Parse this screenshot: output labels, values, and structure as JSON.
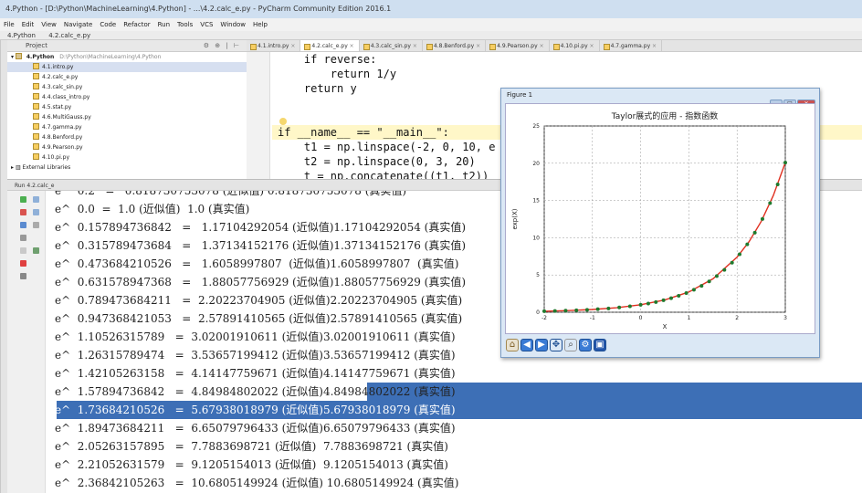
{
  "window_title": "4.Python - [D:\\Python\\MachineLearning\\4.Python] - ...\\4.2.calc_e.py - PyCharm Community Edition 2016.1",
  "menu": [
    "File",
    "Edit",
    "View",
    "Navigate",
    "Code",
    "Refactor",
    "Run",
    "Tools",
    "VCS",
    "Window",
    "Help"
  ],
  "breadcrumb": [
    "4.Python",
    "4.2.calc_e.py"
  ],
  "project": {
    "header": "Project",
    "root": "4.Python",
    "root_path": "D:\\Python\\MachineLearning\\4.Python",
    "files": [
      "4.1.intro.py",
      "4.2.calc_e.py",
      "4.3.calc_sin.py",
      "4.4.class_intro.py",
      "4.5.stat.py",
      "4.6.MultiGauss.py",
      "4.7.gamma.py",
      "4.8.Benford.py",
      "4.9.Pearson.py",
      "4.10.pi.py"
    ],
    "external": "External Libraries"
  },
  "tabs": [
    "4.1.intro.py",
    "4.2.calc_e.py",
    "4.3.calc_sin.py",
    "4.8.Benford.py",
    "4.9.Pearson.py",
    "4.10.pi.py",
    "4.7.gamma.py"
  ],
  "active_tab": 1,
  "code": {
    "l1": "    if reverse:",
    "l2": "        return 1/y",
    "l3": "    return y",
    "l4": "if __name__ == \"__main__\":",
    "l5": "    t1 = np.linspace(-2, 0, 10, e",
    "l6": "    t2 = np.linspace(0, 3, 20)",
    "l7": "    t = np.concatenate((t1, t2))"
  },
  "run_tab": "Run  4.2.calc_e",
  "console": [
    "e^  0.2   =   0.818730753078 (近似值) 0.818730753078 (真实值)",
    "e^  0.0  =  1.0 (近似值)  1.0 (真实值)",
    "e^  0.157894736842   =   1.17104292054 (近似值)1.17104292054 (真实值)",
    "e^  0.315789473684   =   1.37134152176 (近似值)1.37134152176 (真实值)",
    "e^  0.473684210526   =   1.6058997807  (近似值)1.6058997807  (真实值)",
    "e^  0.631578947368   =   1.88057756929 (近似值)1.88057756929 (真实值)",
    "e^  0.789473684211   =  2.20223704905 (近似值)2.20223704905 (真实值)",
    "e^  0.947368421053   =  2.57891410565 (近似值)2.57891410565 (真实值)",
    "e^  1.10526315789   =  3.02001910611 (近似值)3.02001910611 (真实值)",
    "e^  1.26315789474   =  3.53657199412 (近似值)3.53657199412 (真实值)",
    "e^  1.42105263158   =  4.14147759671 (近似值)4.14147759671 (真实值)",
    "e^  1.57894736842   =  4.84984802022 (近似值)4.84984802022 (真实值)",
    "e^  1.73684210526   =  5.67938018979 (近似值)5.67938018979 (真实值)",
    "e^  1.89473684211   =  6.65079796433 (近似值)6.65079796433 (真实值)",
    "e^  2.05263157895   =  7.7883698721 (近似值)  7.7883698721 (真实值)",
    "e^  2.21052631579   =  9.1205154013 (近似值)  9.1205154013 (真实值)",
    "e^  2.36842105263   =  10.6805149924 (近似值) 10.6805149924 (真实值)"
  ],
  "figure": {
    "title": "Figure 1",
    "toolbar": [
      "home-icon",
      "back-icon",
      "forward-icon",
      "pan-icon",
      "zoom-icon",
      "configure-icon",
      "save-icon"
    ]
  },
  "chart_data": {
    "type": "line",
    "title": "Taylor展式的应用 - 指数函数",
    "xlabel": "X",
    "ylabel": "exp(X)",
    "xlim": [
      -2,
      3
    ],
    "ylim": [
      0,
      25
    ],
    "xticks": [
      "-2",
      "-1",
      "0",
      "1",
      "2",
      "3"
    ],
    "yticks": [
      "0",
      "5",
      "10",
      "15",
      "20",
      "25"
    ],
    "grid": true,
    "line_color": "#e03020",
    "marker_color": "#1f7a2e",
    "series": [
      {
        "kind": "line",
        "x": [
          -2.0,
          -1.5,
          -1.0,
          -0.5,
          0.0,
          0.5,
          1.0,
          1.5,
          2.0,
          2.25,
          2.5,
          2.75,
          3.0
        ],
        "y": [
          0.135,
          0.223,
          0.368,
          0.607,
          1.0,
          1.649,
          2.718,
          4.482,
          7.389,
          9.488,
          12.182,
          15.643,
          20.086
        ]
      },
      {
        "kind": "markers",
        "x": [
          -2.0,
          -1.778,
          -1.556,
          -1.333,
          -1.111,
          -0.889,
          -0.667,
          -0.444,
          -0.222,
          0.0,
          0.158,
          0.316,
          0.474,
          0.632,
          0.789,
          0.947,
          1.105,
          1.263,
          1.421,
          1.579,
          1.737,
          1.895,
          2.053,
          2.211,
          2.368,
          2.526,
          2.684,
          2.842,
          3.0
        ],
        "y": [
          0.135,
          0.169,
          0.211,
          0.264,
          0.329,
          0.411,
          0.513,
          0.641,
          0.801,
          1.0,
          1.171,
          1.371,
          1.606,
          1.881,
          2.202,
          2.579,
          3.02,
          3.537,
          4.141,
          4.85,
          5.679,
          6.651,
          7.788,
          9.121,
          10.681,
          12.508,
          14.647,
          17.152,
          20.086
        ]
      }
    ]
  }
}
